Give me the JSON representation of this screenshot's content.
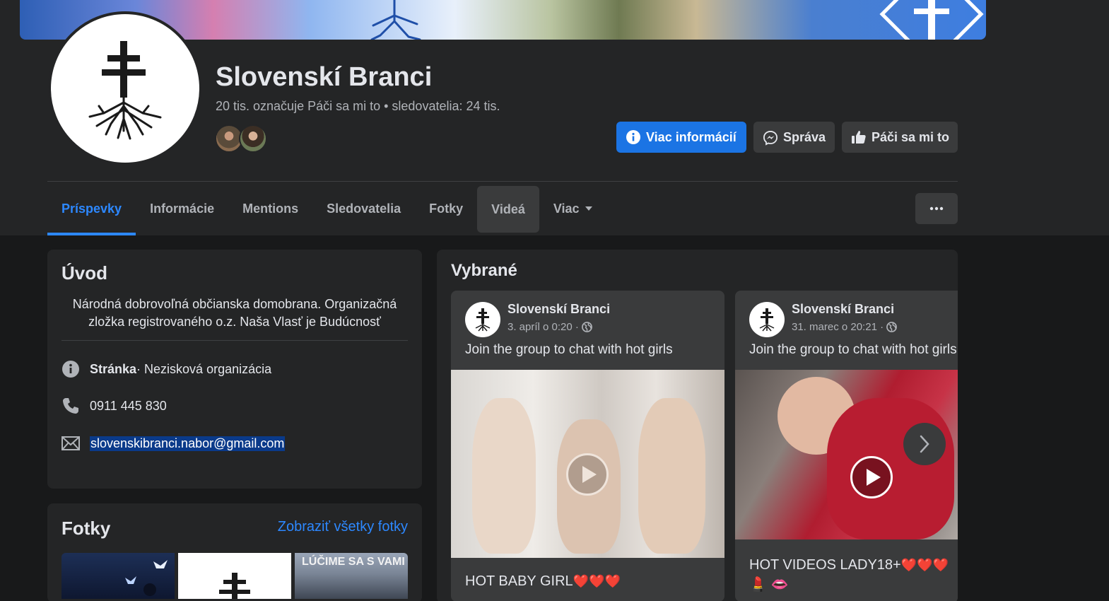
{
  "page": {
    "name": "Slovenskí Branci",
    "stats": "20 tis. označuje Páči sa mi to • sledovatelia: 24 tis."
  },
  "actions": {
    "info_label": "Viac informácií",
    "message_label": "Správa",
    "like_label": "Páči sa mi to"
  },
  "tabs": [
    {
      "label": "Príspevky",
      "active": true
    },
    {
      "label": "Informácie"
    },
    {
      "label": "Mentions"
    },
    {
      "label": "Sledovatelia"
    },
    {
      "label": "Fotky"
    },
    {
      "label": "Videá"
    },
    {
      "label": "Viac"
    }
  ],
  "intro": {
    "title": "Úvod",
    "description": "Národná dobrovoľná občianska domobrana. Organizačná zložka registrovaného o.z. Naša Vlasť je Budúcnosť",
    "type_strong": "Stránka",
    "type_rest": " · Nezisková organizácia",
    "phone": "0911 445 830",
    "email": "slovenskibranci.nabor@gmail.com"
  },
  "photos": {
    "title": "Fotky",
    "see_all": "Zobraziť všetky fotky",
    "thumb3_caption": "LÚČIME SA S VAMI"
  },
  "featured": {
    "title": "Vybrané",
    "posts": [
      {
        "author": "Slovenskí Branci",
        "time": "3. apríl o 0:20 ·",
        "text": "Join the group to chat with hot girls",
        "caption": "HOT BABY GIRL",
        "caption_emoji": "❤️❤️❤️"
      },
      {
        "author": "Slovenskí Branci",
        "time": "31. marec o 20:21 ·",
        "text": "Join the group to chat with hot girls",
        "caption": "HOT VIDEOS LADY18+",
        "caption_emoji": "❤️❤️❤️",
        "caption_line2": "💄 👄"
      }
    ]
  },
  "colors": {
    "accent": "#2d88ff",
    "primary_button": "#1b74e4",
    "surface": "#242526",
    "background": "#18191a"
  }
}
